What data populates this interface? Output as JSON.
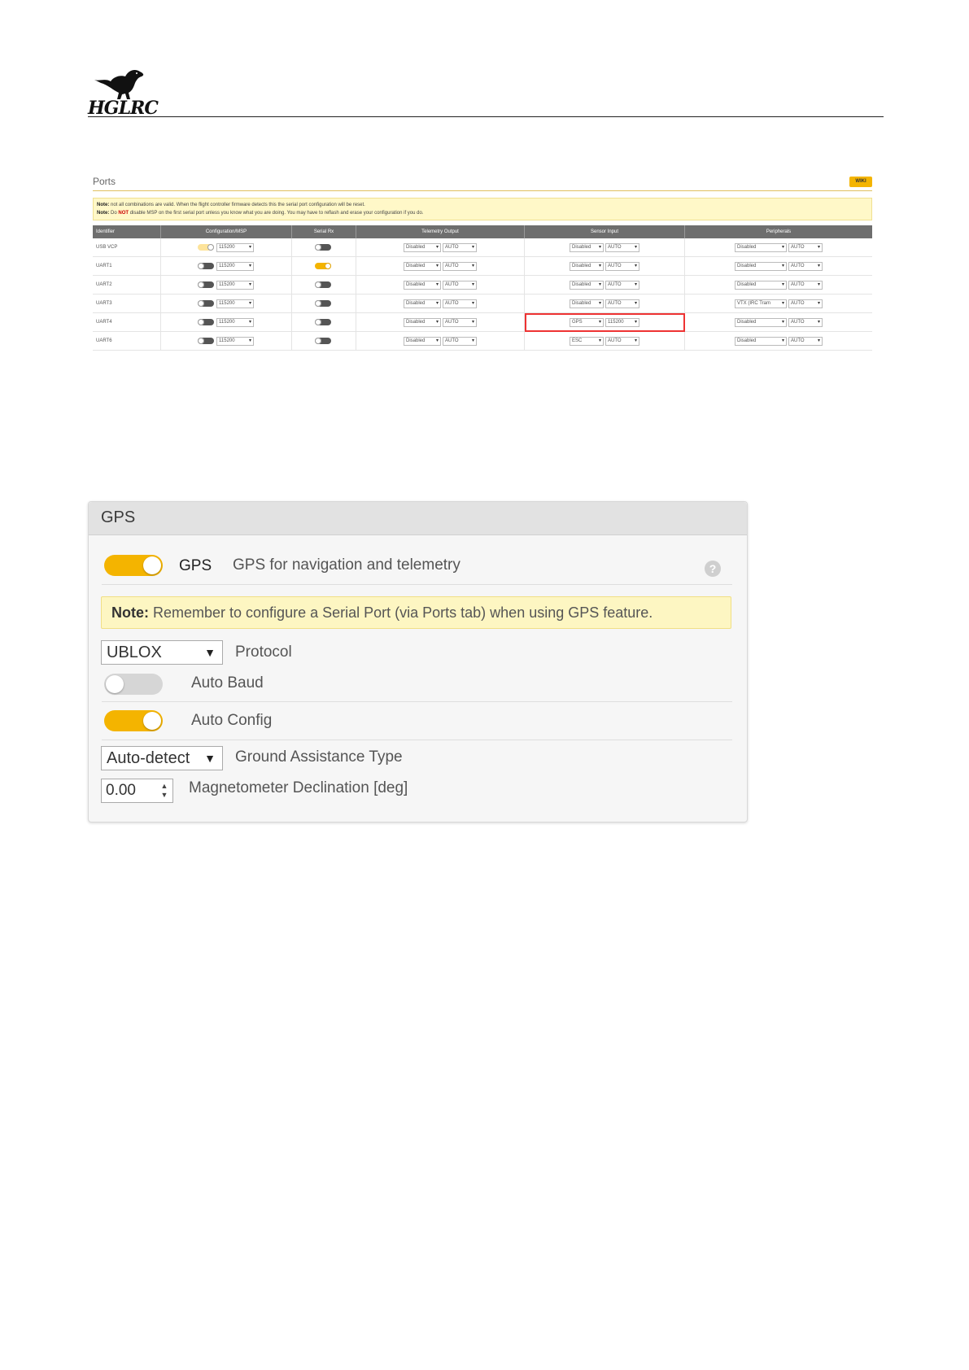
{
  "header": {
    "logo_text": "HGLRC"
  },
  "ports": {
    "title": "Ports",
    "wiki_label": "WIKI",
    "note1_bold": "Note:",
    "note1_text": " not all combinations are valid. When the flight controller firmware detects this the serial port configuration will be reset.",
    "note2_bold": "Note:",
    "note2_pre": " Do ",
    "note2_red": "NOT",
    "note2_post": " disable MSP on the first serial port unless you know what you are doing. You may have to reflash and erase your configuration if you do.",
    "columns": [
      "Identifier",
      "Configuration/MSP",
      "Serial Rx",
      "Telemetry Output",
      "Sensor Input",
      "Peripherals"
    ],
    "rows": [
      {
        "id": "USB VCP",
        "msp_on": true,
        "msp_baud": "115200",
        "rx_on": false,
        "tel": "Disabled",
        "tel_baud": "AUTO",
        "sensor": "Disabled",
        "sensor_baud": "AUTO",
        "periph": "Disabled",
        "periph_baud": "AUTO"
      },
      {
        "id": "UART1",
        "msp_on": false,
        "msp_baud": "115200",
        "rx_on": true,
        "tel": "Disabled",
        "tel_baud": "AUTO",
        "sensor": "Disabled",
        "sensor_baud": "AUTO",
        "periph": "Disabled",
        "periph_baud": "AUTO"
      },
      {
        "id": "UART2",
        "msp_on": false,
        "msp_baud": "115200",
        "rx_on": false,
        "tel": "Disabled",
        "tel_baud": "AUTO",
        "sensor": "Disabled",
        "sensor_baud": "AUTO",
        "periph": "Disabled",
        "periph_baud": "AUTO"
      },
      {
        "id": "UART3",
        "msp_on": false,
        "msp_baud": "115200",
        "rx_on": false,
        "tel": "Disabled",
        "tel_baud": "AUTO",
        "sensor": "Disabled",
        "sensor_baud": "AUTO",
        "periph": "VTX (IRC Tram",
        "periph_baud": "AUTO"
      },
      {
        "id": "UART4",
        "msp_on": false,
        "msp_baud": "115200",
        "rx_on": false,
        "tel": "Disabled",
        "tel_baud": "AUTO",
        "sensor": "GPS",
        "sensor_baud": "115200",
        "periph": "Disabled",
        "periph_baud": "AUTO"
      },
      {
        "id": "UART6",
        "msp_on": false,
        "msp_baud": "115200",
        "rx_on": false,
        "tel": "Disabled",
        "tel_baud": "AUTO",
        "sensor": "ESC",
        "sensor_baud": "AUTO",
        "periph": "Disabled",
        "periph_baud": "AUTO"
      }
    ]
  },
  "gps": {
    "title": "GPS",
    "feature_label": "GPS",
    "feature_desc": "GPS for navigation and telemetry",
    "feature_enabled": true,
    "help_icon": "?",
    "note_bold": "Note:",
    "note_text": " Remember to configure a Serial Port (via Ports tab) when using GPS feature.",
    "protocol_value": "UBLOX",
    "protocol_label": "Protocol",
    "auto_baud_label": "Auto Baud",
    "auto_baud_enabled": false,
    "auto_config_label": "Auto Config",
    "auto_config_enabled": true,
    "ground_assist_value": "Auto-detect",
    "ground_assist_label": "Ground Assistance Type",
    "mag_decl_value": "0.00",
    "mag_decl_label": "Magnetometer Declination [deg]"
  },
  "colors": {
    "accent": "#f4b400",
    "note_bg": "#fdf6c2",
    "highlight": "#e33333"
  }
}
